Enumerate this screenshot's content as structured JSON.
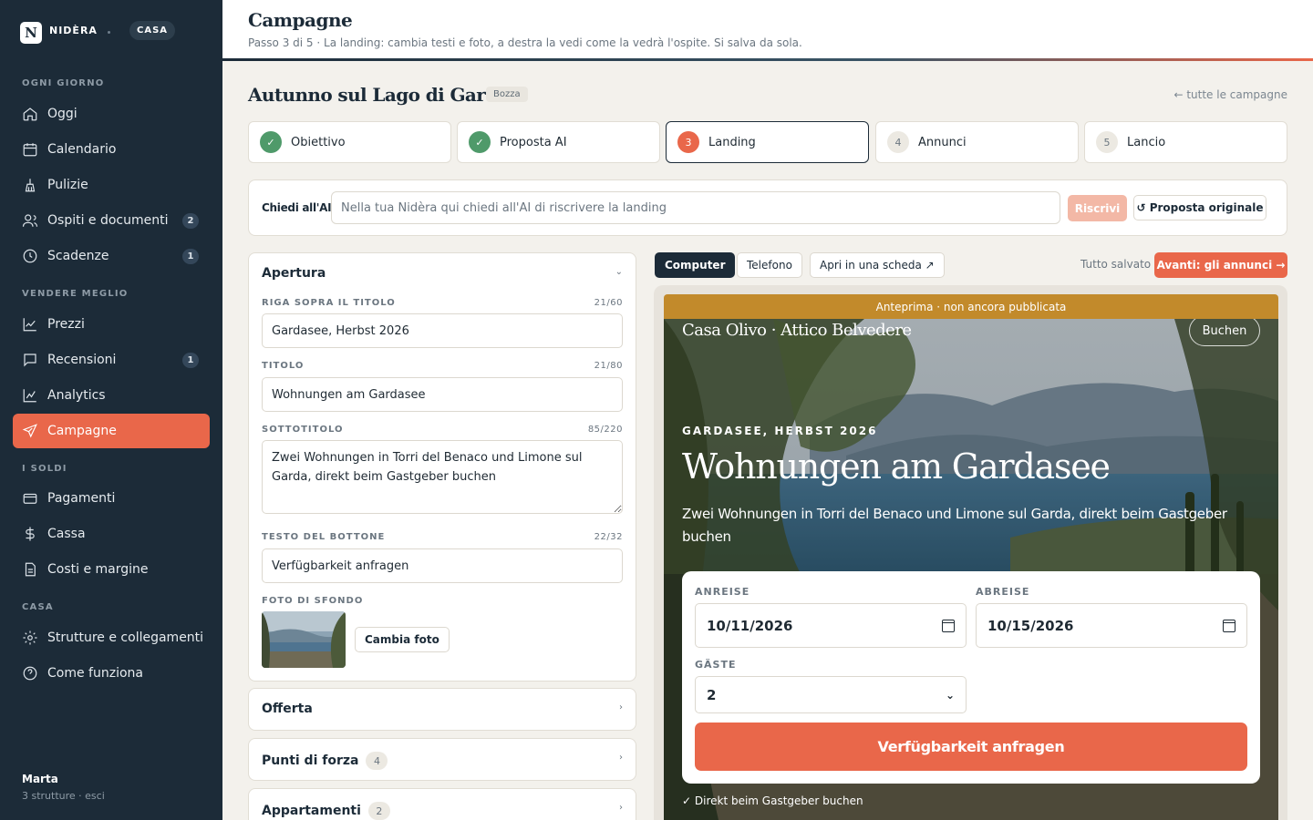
{
  "brand": {
    "logo_letter": "N",
    "name": "NIDÈRA",
    "property_pill": "CASA"
  },
  "sidebar": {
    "sections": [
      {
        "title": "OGNI GIORNO",
        "items": [
          {
            "label": "Oggi",
            "icon": "home-icon",
            "badge": ""
          },
          {
            "label": "Calendario",
            "icon": "calendar-icon",
            "badge": ""
          },
          {
            "label": "Pulizie",
            "icon": "broom-icon",
            "badge": ""
          },
          {
            "label": "Ospiti e documenti",
            "icon": "users-icon",
            "badge": "2"
          },
          {
            "label": "Scadenze",
            "icon": "clock-icon",
            "badge": "1"
          }
        ]
      },
      {
        "title": "VENDERE MEGLIO",
        "items": [
          {
            "label": "Prezzi",
            "icon": "chart-line-icon",
            "badge": ""
          },
          {
            "label": "Recensioni",
            "icon": "message-icon",
            "badge": "1"
          },
          {
            "label": "Analytics",
            "icon": "analytics-icon",
            "badge": ""
          },
          {
            "label": "Campagne",
            "icon": "send-icon",
            "badge": "",
            "active": true
          }
        ]
      },
      {
        "title": "I SOLDI",
        "items": [
          {
            "label": "Pagamenti",
            "icon": "card-icon",
            "badge": ""
          },
          {
            "label": "Cassa",
            "icon": "dollar-icon",
            "badge": ""
          },
          {
            "label": "Costi e margine",
            "icon": "document-icon",
            "badge": ""
          }
        ]
      },
      {
        "title": "CASA",
        "items": [
          {
            "label": "Strutture e collegamenti",
            "icon": "gear-icon",
            "badge": ""
          },
          {
            "label": "Come funziona",
            "icon": "help-icon",
            "badge": ""
          }
        ]
      }
    ],
    "user": {
      "name": "Marta",
      "sub": "3 strutture · esci"
    }
  },
  "header": {
    "title": "Campagne",
    "subtitle": "Passo 3 di 5 · La landing: cambia testi e foto, a destra la vedi come la vedrà l'ospite. Si salva da sola."
  },
  "campaign": {
    "title": "Autunno sul Lago di Garda",
    "status": "Bozza",
    "back_link": "← tutte le campagne"
  },
  "steps": [
    {
      "num": "✓",
      "label": "Obiettivo",
      "state": "done"
    },
    {
      "num": "✓",
      "label": "Proposta AI",
      "state": "done"
    },
    {
      "num": "3",
      "label": "Landing",
      "state": "current"
    },
    {
      "num": "4",
      "label": "Annunci",
      "state": "todo"
    },
    {
      "num": "5",
      "label": "Lancio",
      "state": "todo"
    }
  ],
  "ai": {
    "label": "Chiedi all'AI",
    "placeholder": "Nella tua Nidèra qui chiedi all'AI di riscrivere la landing",
    "rewrite": "Riscrivi",
    "original": "↺ Proposta originale"
  },
  "form": {
    "apertura": {
      "title": "Apertura",
      "chevron": "⌄",
      "kicker": {
        "label": "RIGA SOPRA IL TITOLO",
        "count": "21/60",
        "value": "Gardasee, Herbst 2026"
      },
      "title_field": {
        "label": "TITOLO",
        "count": "21/80",
        "value": "Wohnungen am Gardasee"
      },
      "subtitle": {
        "label": "SOTTOTITOLO",
        "count": "85/220",
        "value": "Zwei Wohnungen in Torri del Benaco und Limone sul Garda, direkt beim Gastgeber buchen"
      },
      "button_text": {
        "label": "TESTO DEL BOTTONE",
        "count": "22/32",
        "value": "Verfügbarkeit anfragen"
      },
      "photo": {
        "label": "FOTO DI SFONDO",
        "change": "Cambia foto"
      }
    },
    "collapsed": [
      {
        "title": "Offerta",
        "count": ""
      },
      {
        "title": "Punti di forza",
        "count": "4"
      },
      {
        "title": "Appartamenti",
        "count": "2"
      }
    ],
    "collapsed_chevron": "›"
  },
  "preview": {
    "modes": [
      "Computer",
      "Telefono",
      "Apri in una scheda ↗"
    ],
    "saved": "Tutto salvato",
    "next": "Avanti: gli annunci →",
    "banner": "Anteprima · non ancora pubblicata",
    "brand": "Casa Olivo · Attico Belvedere",
    "book": "Buchen",
    "kicker": "GARDASEE, HERBST 2026",
    "title": "Wohnungen am Gardasee",
    "subtitle": "Zwei Wohnungen in Torri del Benaco und Limone sul Garda, direkt beim Gastgeber buchen",
    "arrival_label": "ANREISE",
    "arrival": "10/11/2026",
    "departure_label": "ABREISE",
    "departure": "10/15/2026",
    "guests_label": "GÄSTE",
    "guests": "2",
    "cta": "Verfügbarkeit anfragen",
    "footnote": "✓ Direkt beim Gastgeber buchen"
  },
  "colors": {
    "sidebar": "#1c2b38",
    "accent": "#e9674a",
    "done": "#4f9a6a",
    "banner": "#c28a2b"
  }
}
